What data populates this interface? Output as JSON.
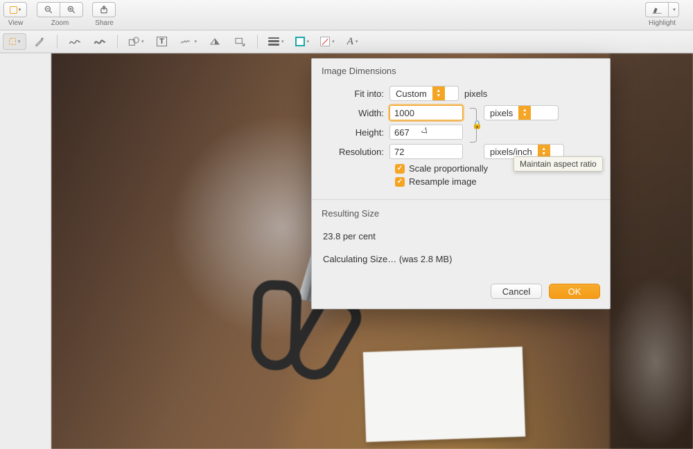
{
  "toolbar": {
    "view_label": "View",
    "zoom_label": "Zoom",
    "share_label": "Share",
    "highlight_label": "Highlight"
  },
  "markup": {
    "font_letter": "A",
    "text_tool_letter": "T"
  },
  "dialog": {
    "section_dimensions": "Image Dimensions",
    "fit_into_label": "Fit into:",
    "fit_into_value": "Custom",
    "fit_into_unit": "pixels",
    "width_label": "Width:",
    "width_value": "1000",
    "height_label": "Height:",
    "height_value": "667",
    "wh_unit_value": "pixels",
    "resolution_label": "Resolution:",
    "resolution_value": "72",
    "resolution_unit_value": "pixels/inch",
    "scale_proportionally": "Scale proportionally",
    "resample_image": "Resample image",
    "section_resulting": "Resulting Size",
    "percent_line": "23.8 per cent",
    "calc_line": "Calculating Size… (was 2.8 MB)",
    "cancel": "Cancel",
    "ok": "OK"
  },
  "tooltip": {
    "text": "Maintain aspect ratio"
  }
}
